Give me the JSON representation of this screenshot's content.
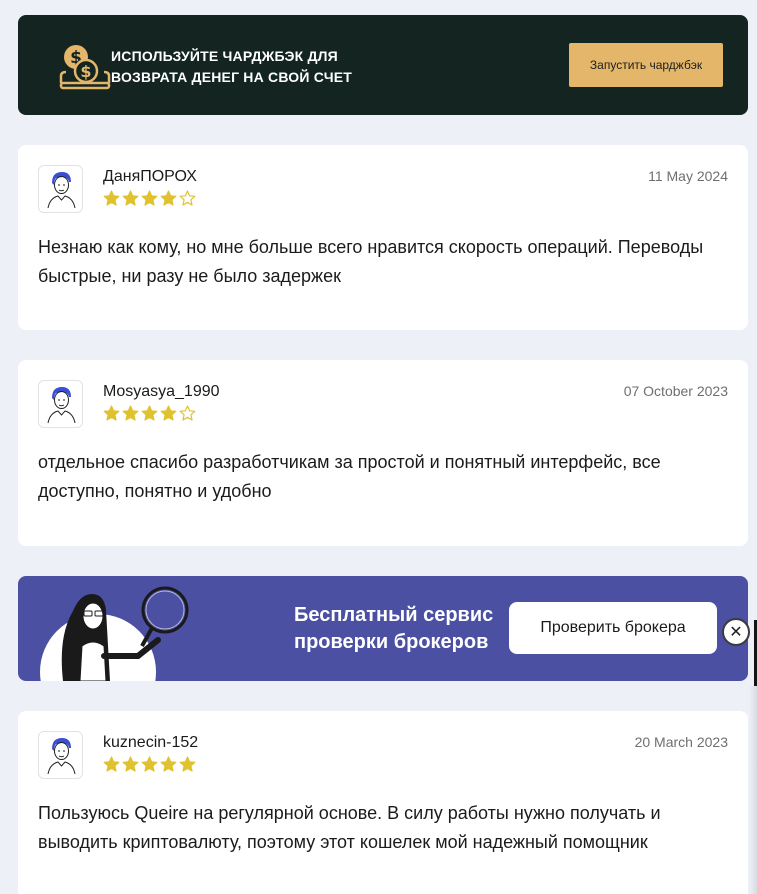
{
  "chargeback": {
    "text": "ИСПОЛЬЗУЙТЕ ЧАРДЖБЭК ДЛЯ ВОЗВРАТА ДЕНЕГ НА СВОЙ СЧЕТ",
    "button_label": "Запустить чарджбэк",
    "icon": "coins-dollar-icon"
  },
  "reviews": [
    {
      "author": "ДаняПОРОХ",
      "date": "11 May 2024",
      "rating": 4,
      "max_rating": 5,
      "text": "Незнаю как кому, но мне больше всего нравится скорость операций. Переводы быстрые, ни разу не было задержек"
    },
    {
      "author": "Mosyasya_1990",
      "date": "07 October 2023",
      "rating": 4,
      "max_rating": 5,
      "text": "отдельное спасибо разработчикам за простой и понятный интерфейс, все доступно, понятно и удобно"
    },
    {
      "author": "kuznecin-152",
      "date": "20 March 2023",
      "rating": 5,
      "max_rating": 5,
      "text": "Пользуюсь Queire на регулярной основе. В силу работы нужно получать и выводить криптовалюту, поэтому этот кошелек мой надежный помощник"
    }
  ],
  "promo": {
    "text": "Бесплатный сервис проверки брокеров",
    "button_label": "Проверить брокера",
    "close_glyph": "✕"
  },
  "colors": {
    "star": "#e0c22e",
    "chargeback_bg": "#132421",
    "chargeback_button": "#e3b66a",
    "promo_bg": "#4b50a3"
  }
}
